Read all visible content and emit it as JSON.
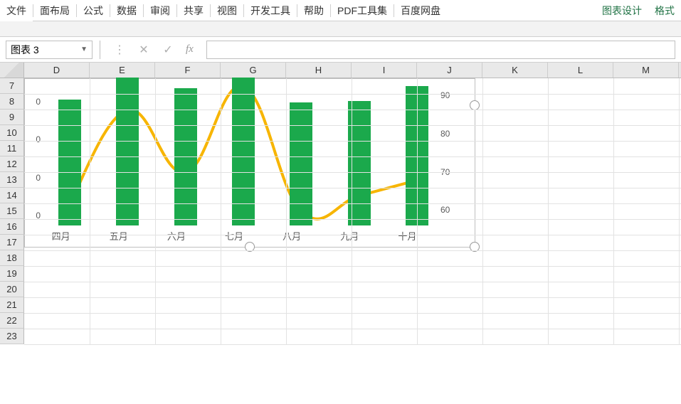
{
  "ribbon": {
    "tabs": [
      "文件",
      "面布局",
      "公式",
      "数据",
      "审阅",
      "共享",
      "视图",
      "开发工具",
      "帮助",
      "PDF工具集",
      "百度网盘"
    ],
    "contextual": [
      "图表设计",
      "格式"
    ]
  },
  "namebox": {
    "value": "图表 3",
    "fx": "fx"
  },
  "columns": [
    "D",
    "E",
    "F",
    "G",
    "H",
    "I",
    "J",
    "K",
    "L",
    "M"
  ],
  "rows": [
    "7",
    "8",
    "9",
    "10",
    "11",
    "12",
    "13",
    "14",
    "15",
    "16",
    "17",
    "18",
    "19",
    "20",
    "21",
    "22",
    "23"
  ],
  "chart_data": {
    "type": "combo",
    "categories": [
      "四月",
      "五月",
      "六月",
      "七月",
      "八月",
      "九月",
      "十月"
    ],
    "series": [
      {
        "name": "bars",
        "type": "bar",
        "axis": "left",
        "values_relative_height": [
          0.85,
          1.0,
          0.93,
          1.0,
          0.83,
          0.84,
          0.94
        ]
      },
      {
        "name": "line",
        "type": "line",
        "axis": "right",
        "values": [
          62,
          86,
          70,
          92,
          60,
          64,
          68
        ]
      }
    ],
    "left_axis": {
      "visible_ticks": [
        "0",
        "0",
        "0",
        "0"
      ],
      "ylim": null
    },
    "right_axis": {
      "ticks": [
        60,
        70,
        80,
        90
      ],
      "ylim": [
        56,
        94
      ]
    },
    "xlabel": "",
    "ylabel": "",
    "title": "",
    "colors": {
      "bar": "#1ba94c",
      "line": "#f7b500"
    }
  }
}
